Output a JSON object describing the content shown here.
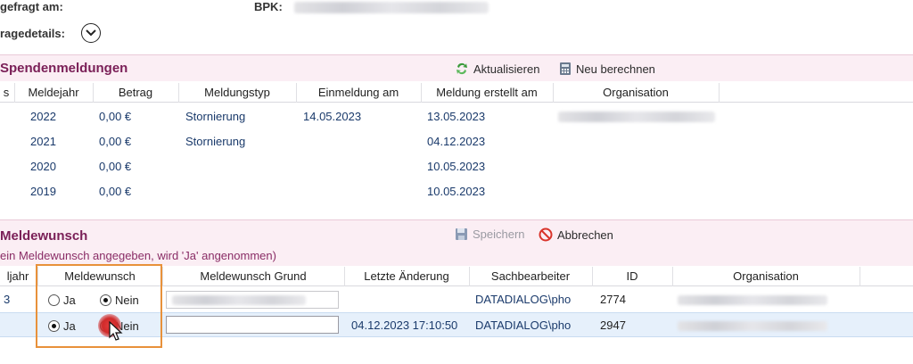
{
  "header": {
    "requested_label": "gefragt am:",
    "bpk_label": "BPK:",
    "details_label": "ragedetails:"
  },
  "donations": {
    "title": "Spendenmeldungen",
    "refresh_label": "Aktualisieren",
    "recalc_label": "Neu berechnen",
    "columns": [
      "s",
      "Meldejahr",
      "Betrag",
      "Meldungstyp",
      "Einmeldung am",
      "Meldung erstellt am",
      "Organisation"
    ],
    "rows": [
      {
        "year": "2022",
        "amount": "0,00 €",
        "type": "Stornierung",
        "reported": "14.05.2023",
        "created": "13.05.2023"
      },
      {
        "year": "2021",
        "amount": "0,00 €",
        "type": "Stornierung",
        "reported": "",
        "created": "04.12.2023"
      },
      {
        "year": "2020",
        "amount": "0,00 €",
        "type": "",
        "reported": "",
        "created": "10.05.2023"
      },
      {
        "year": "2019",
        "amount": "0,00 €",
        "type": "",
        "reported": "",
        "created": "10.05.2023"
      }
    ]
  },
  "wish": {
    "title": "Meldewunsch",
    "hint": "ein Meldewunsch angegeben, wird 'Ja' angenommen)",
    "save_label": "Speichern",
    "cancel_label": "Abbrechen",
    "columns": [
      "ljahr",
      "Meldewunsch",
      "Meldewunsch Grund",
      "Letzte Änderung",
      "Sachbearbeiter",
      "ID",
      "Organisation"
    ],
    "yes_label": "Ja",
    "no_label": "Nein",
    "rows": [
      {
        "year_frag": "3",
        "choice": "Nein",
        "changed": "",
        "clerk": "DATADIALOG\\pho",
        "id": "2774"
      },
      {
        "year_frag": "",
        "choice": "Ja",
        "changed": "04.12.2023 17:10:50",
        "clerk": "DATADIALOG\\pho",
        "id": "2947"
      }
    ]
  },
  "colors": {
    "section_bg": "#fbeef4",
    "section_title": "#7a1f57",
    "highlight_border": "#e8913a",
    "selected_row": "#e6f0fb"
  }
}
